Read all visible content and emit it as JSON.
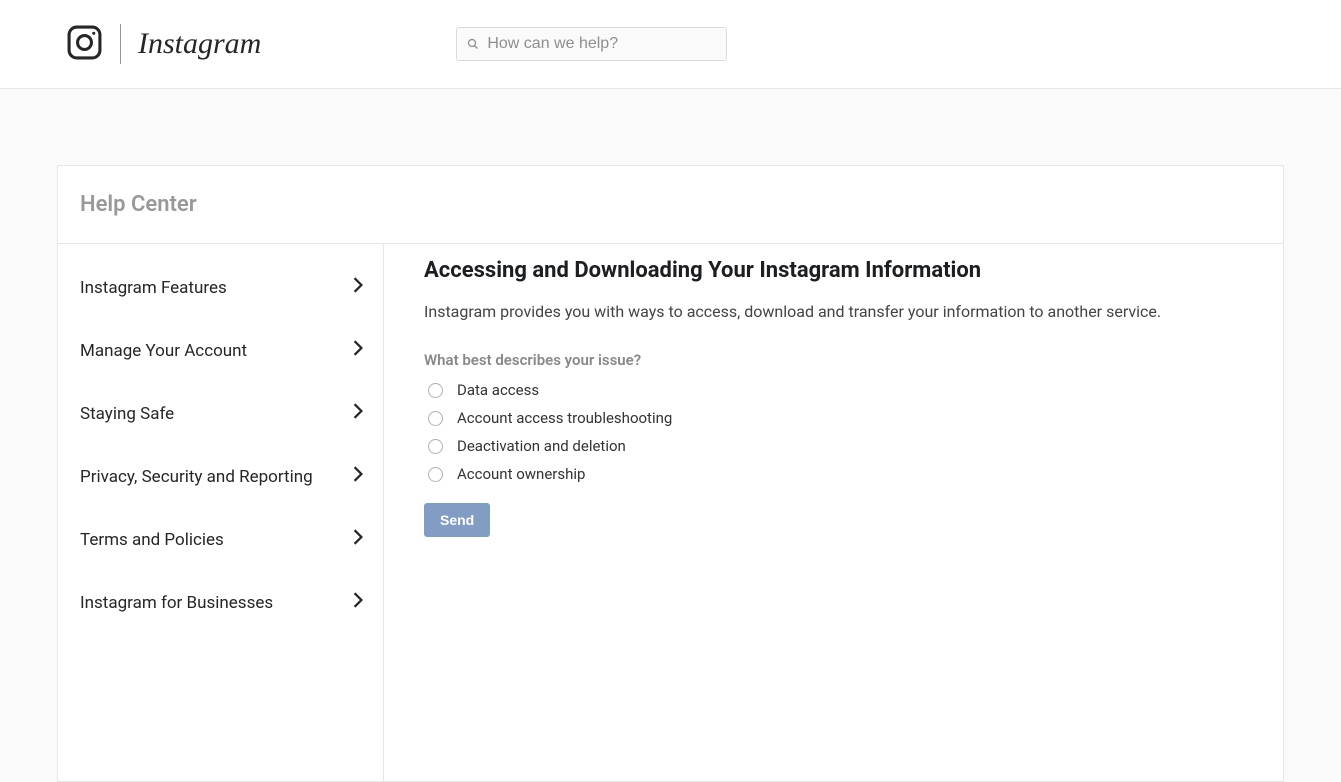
{
  "header": {
    "brand": "Instagram",
    "search_placeholder": "How can we help?"
  },
  "help_center": {
    "title": "Help Center"
  },
  "sidebar": {
    "items": [
      {
        "label": "Instagram Features"
      },
      {
        "label": "Manage Your Account"
      },
      {
        "label": "Staying Safe"
      },
      {
        "label": "Privacy, Security and Reporting"
      },
      {
        "label": "Terms and Policies"
      },
      {
        "label": "Instagram for Businesses"
      }
    ]
  },
  "main": {
    "title": "Accessing and Downloading Your Instagram Information",
    "intro": "Instagram provides you with ways to access, download and transfer your information to another service.",
    "question": "What best describes your issue?",
    "options": [
      {
        "label": "Data access"
      },
      {
        "label": "Account access troubleshooting"
      },
      {
        "label": "Deactivation and deletion"
      },
      {
        "label": "Account ownership"
      }
    ],
    "send_label": "Send"
  }
}
